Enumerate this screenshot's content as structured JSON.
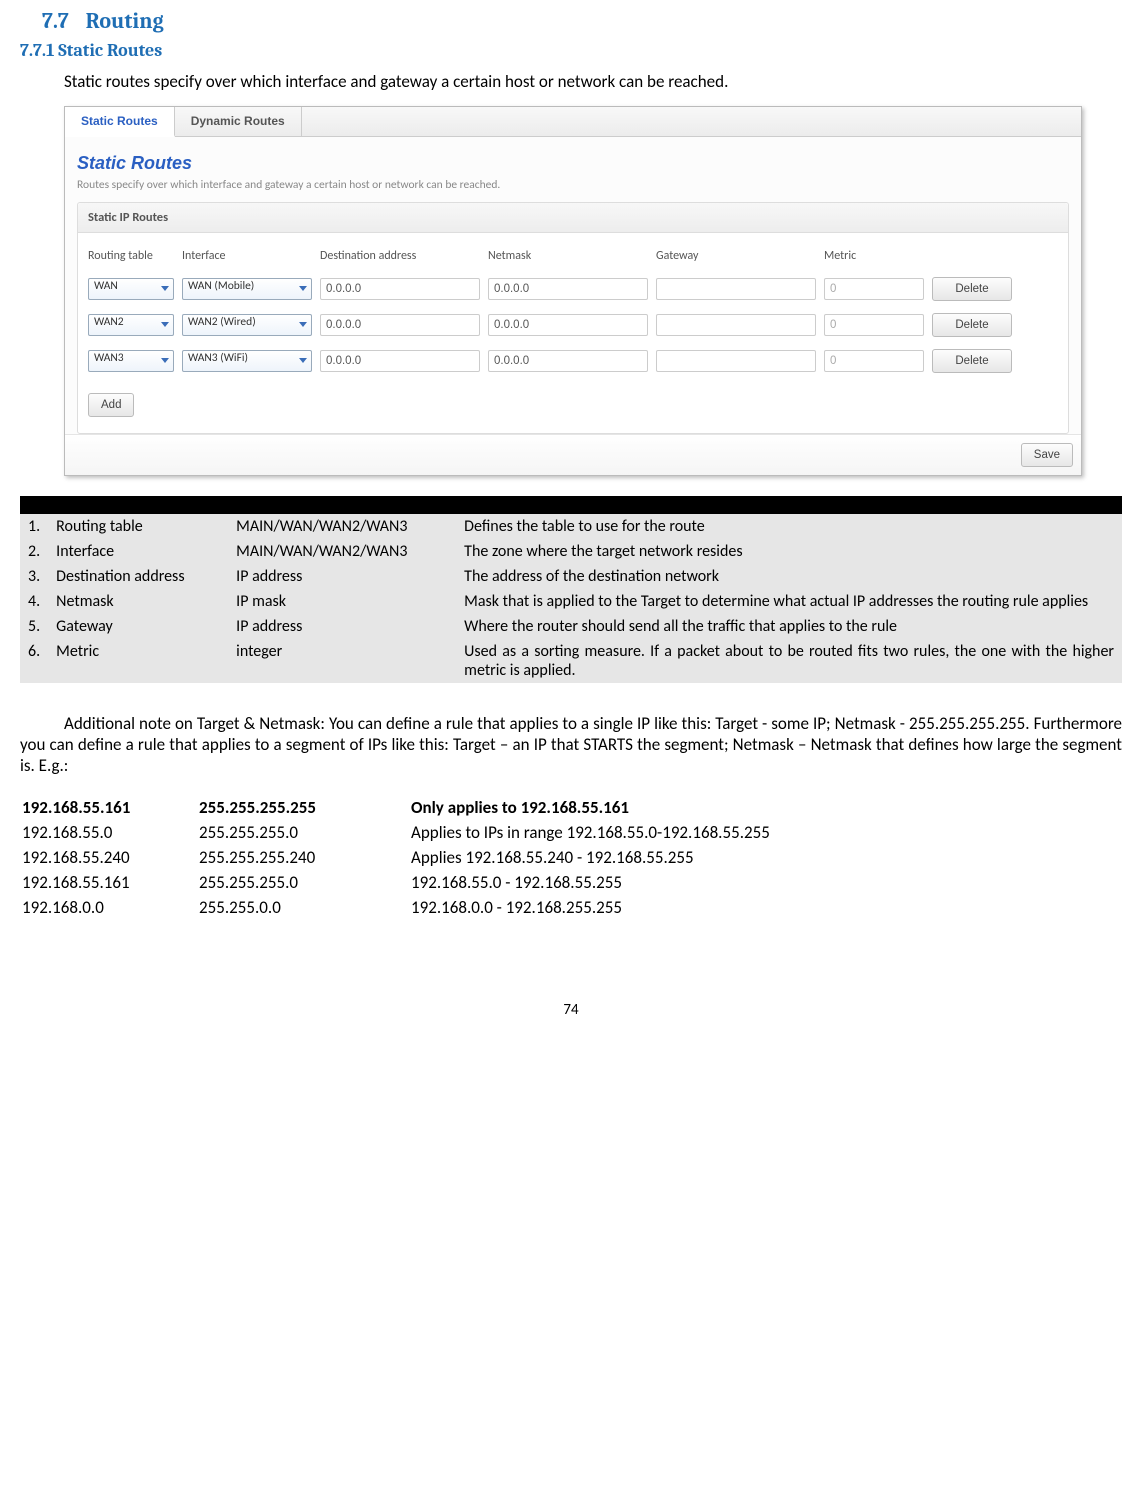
{
  "headings": {
    "h1_num": "7.7",
    "h1_text": "Routing",
    "h2": "7.7.1 Static Routes"
  },
  "intro": "Static routes specify over which interface and gateway a certain host or network can be reached.",
  "screenshot": {
    "tabs": {
      "active": "Static Routes",
      "other": "Dynamic Routes"
    },
    "title": "Static Routes",
    "desc": "Routes specify over which interface and gateway a certain host or network can be reached.",
    "legend": "Static IP Routes",
    "headers": {
      "rt": "Routing table",
      "iface": "Interface",
      "dest": "Destination address",
      "mask": "Netmask",
      "gw": "Gateway",
      "metric": "Metric"
    },
    "rows": [
      {
        "rt": "WAN",
        "iface": "WAN (Mobile)",
        "dest": "0.0.0.0",
        "mask": "0.0.0.0",
        "gw": "",
        "metric": "0"
      },
      {
        "rt": "WAN2",
        "iface": "WAN2 (Wired)",
        "dest": "0.0.0.0",
        "mask": "0.0.0.0",
        "gw": "",
        "metric": "0"
      },
      {
        "rt": "WAN3",
        "iface": "WAN3 (WiFi)",
        "dest": "0.0.0.0",
        "mask": "0.0.0.0",
        "gw": "",
        "metric": "0"
      }
    ],
    "buttons": {
      "delete": "Delete",
      "add": "Add",
      "save": "Save"
    }
  },
  "ref_rows": [
    {
      "n": "1.",
      "field": "Routing table",
      "sample": "MAIN/WAN/WAN2/WAN3",
      "exp": "Defines the table to use for the route"
    },
    {
      "n": "2.",
      "field": "Interface",
      "sample": "MAIN/WAN/WAN2/WAN3",
      "exp": "The zone where the target network resides"
    },
    {
      "n": "3.",
      "field": "Destination address",
      "sample": "IP address",
      "exp": "The address of the destination network"
    },
    {
      "n": "4.",
      "field": "Netmask",
      "sample": "IP mask",
      "exp": "Mask that is applied to the Target to determine what actual IP addresses the routing rule applies"
    },
    {
      "n": "5.",
      "field": "Gateway",
      "sample": "IP address",
      "exp": "Where the router should send all the traffic that applies to the rule"
    },
    {
      "n": "6.",
      "field": "Metric",
      "sample": "integer",
      "exp": "Used as a sorting measure. If a packet about to be routed fits two rules, the one with the higher metric is applied."
    }
  ],
  "note": "Additional note on Target & Netmask: You can define a rule that applies to a single IP like this: Target - some IP; Netmask - 255.255.255.255. Furthermore you can define a rule that applies to a segment of IPs like this: Target – an IP that STARTS the segment; Netmask – Netmask that defines how large the segment is. E.g.:",
  "examples": [
    {
      "ip": "192.168.55.161",
      "mask": "255.255.255.255",
      "desc": "Only applies to 192.168.55.161",
      "bold": true
    },
    {
      "ip": "192.168.55.0",
      "mask": "255.255.255.0",
      "desc": "Applies to IPs in range 192.168.55.0-192.168.55.255"
    },
    {
      "ip": "192.168.55.240",
      "mask": "255.255.255.240",
      "desc": "Applies 192.168.55.240 -  192.168.55.255"
    },
    {
      "ip": "192.168.55.161",
      "mask": "255.255.255.0",
      "desc": "192.168.55.0 - 192.168.55.255"
    },
    {
      "ip": "192.168.0.0",
      "mask": "255.255.0.0",
      "desc": "192.168.0.0 - 192.168.255.255"
    }
  ],
  "page_number": "74"
}
